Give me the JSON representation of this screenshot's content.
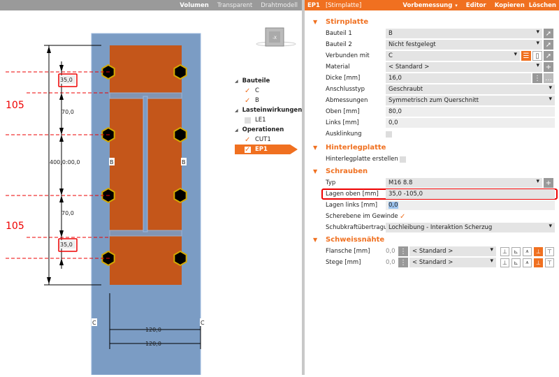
{
  "viewbar": {
    "items": [
      "Volumen",
      "Transparent",
      "Drahtmodell"
    ]
  },
  "header": {
    "id": "EP1",
    "type": "[Stirnplatte]",
    "vorbemessung": "Vorbemessung",
    "editor": "Editor",
    "kopieren": "Kopieren",
    "loeschen": "Löschen"
  },
  "viewcube": {
    "label": "-X"
  },
  "tree": {
    "groups": [
      {
        "label": "Bauteile",
        "items": [
          {
            "label": "C",
            "checked": true
          },
          {
            "label": "B",
            "checked": true
          }
        ]
      },
      {
        "label": "Lasteinwirkungen",
        "items": [
          {
            "label": "LE1",
            "checked": false
          }
        ]
      },
      {
        "label": "Operationen",
        "items": [
          {
            "label": "CUT1",
            "checked": true
          },
          {
            "label": "EP1",
            "checked": true,
            "selected": true
          }
        ]
      }
    ]
  },
  "drawing": {
    "dims": {
      "d1": "35,0",
      "d2": "70,0",
      "d3": "400,0:00,0",
      "d4": "70,0",
      "d5": "35,0",
      "w1": "120,0",
      "w2": "120,0"
    },
    "annot1": "105",
    "annot2": "105",
    "labelB": "B",
    "labelC": "C"
  },
  "panel": {
    "stirnplatte": {
      "title": "Stirnplatte",
      "bauteil1": {
        "label": "Bauteil 1",
        "value": "B"
      },
      "bauteil2": {
        "label": "Bauteil 2",
        "value": "Nicht festgelegt"
      },
      "verbunden": {
        "label": "Verbunden mit",
        "value": "C"
      },
      "material": {
        "label": "Material",
        "value": "< Standard >"
      },
      "dicke": {
        "label": "Dicke [mm]",
        "value": "16,0"
      },
      "anschluss": {
        "label": "Anschlusstyp",
        "value": "Geschraubt"
      },
      "abmessungen": {
        "label": "Abmessungen",
        "value": "Symmetrisch zum Querschnitt"
      },
      "oben": {
        "label": "Oben [mm]",
        "value": "80,0"
      },
      "links": {
        "label": "Links [mm]",
        "value": "0,0"
      },
      "ausklinkung": {
        "label": "Ausklinkung",
        "checked": false
      }
    },
    "hinterleg": {
      "title": "Hinterlegplatte",
      "erstellen": {
        "label": "Hinterlegplatte erstellen",
        "checked": false
      }
    },
    "schrauben": {
      "title": "Schrauben",
      "typ": {
        "label": "Typ",
        "value": "M16 8.8"
      },
      "lagenOben": {
        "label": "Lagen oben [mm]",
        "value": "35,0 -105,0"
      },
      "lagenLinks": {
        "label": "Lagen links [mm]",
        "value": "0,0"
      },
      "scherebene": {
        "label": "Scherebene im Gewinde",
        "checked": true
      },
      "schub": {
        "label": "Schubkraftübertragung",
        "value": "Lochleibung - Interaktion Scherzug"
      }
    },
    "schweiss": {
      "title": "Schweissnähte",
      "flansche": {
        "label": "Flansche [mm]",
        "size": "0,0",
        "value": "< Standard >"
      },
      "stege": {
        "label": "Stege [mm]",
        "size": "0,0",
        "value": "< Standard >"
      }
    }
  },
  "colors": {
    "accent": "#f07020",
    "column": "#7b9cc4",
    "plate": "#c4561a",
    "highlight": "#e00000"
  }
}
